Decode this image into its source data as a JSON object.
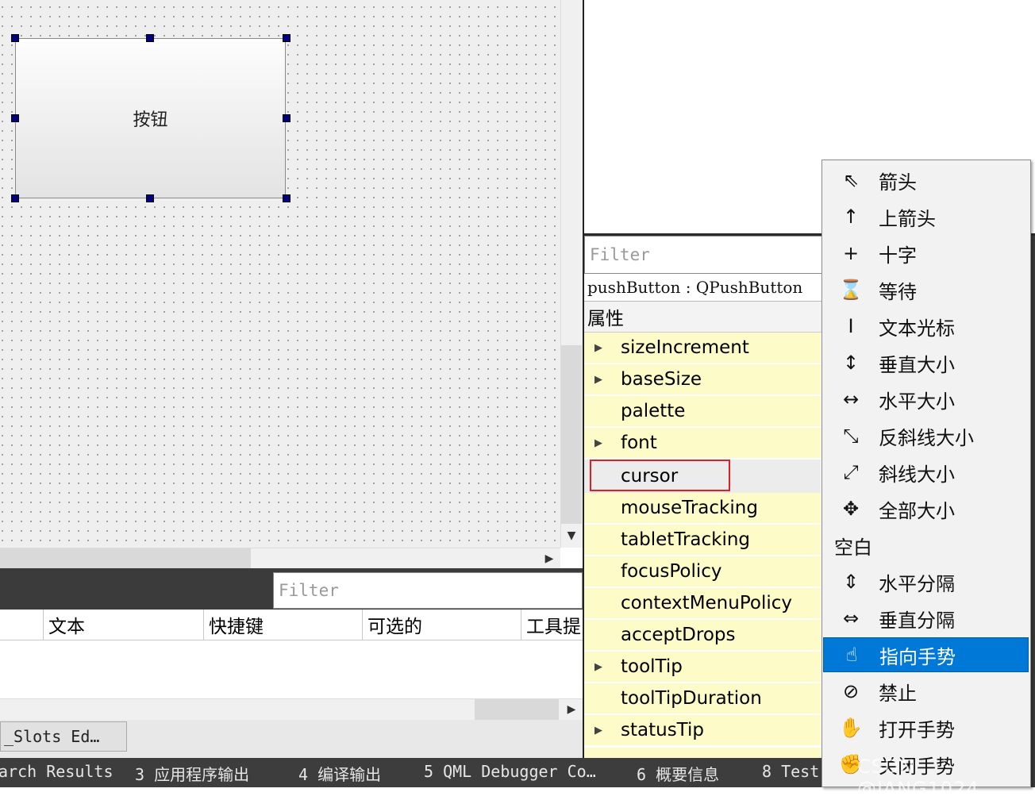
{
  "form_editor": {
    "button_text": "按钮"
  },
  "action_editor": {
    "filter_placeholder": "Filter",
    "columns": [
      "文本",
      "快捷键",
      "可选的",
      "工具提"
    ],
    "tab_label": "_Slots Ed…"
  },
  "output_bar": {
    "items": [
      "arch Results",
      "3  应用程序输出",
      "4  编译输出",
      "5  QML Debugger Co…",
      "6  概要信息",
      "8  Test"
    ]
  },
  "property_editor": {
    "filter_placeholder": "Filter",
    "object_label": "pushButton : QPushButton",
    "header": "属性",
    "rows": [
      {
        "name": "sizeIncrement",
        "expandable": true,
        "shade": "yellow"
      },
      {
        "name": "baseSize",
        "expandable": true,
        "shade": "yellow"
      },
      {
        "name": "palette",
        "expandable": false,
        "shade": "yellow"
      },
      {
        "name": "font",
        "expandable": true,
        "shade": "yellow"
      },
      {
        "name": "cursor",
        "expandable": false,
        "shade": "gray",
        "highlighted": true
      },
      {
        "name": "mouseTracking",
        "expandable": false,
        "shade": "yellow"
      },
      {
        "name": "tabletTracking",
        "expandable": false,
        "shade": "yellow"
      },
      {
        "name": "focusPolicy",
        "expandable": false,
        "shade": "yellow"
      },
      {
        "name": "contextMenuPolicy",
        "expandable": false,
        "shade": "yellow"
      },
      {
        "name": "acceptDrops",
        "expandable": false,
        "shade": "yellow"
      },
      {
        "name": "toolTip",
        "expandable": true,
        "shade": "yellow"
      },
      {
        "name": "toolTipDuration",
        "expandable": false,
        "shade": "yellow"
      },
      {
        "name": "statusTip",
        "expandable": true,
        "shade": "yellow"
      }
    ]
  },
  "cursor_menu": {
    "items": [
      {
        "label": "箭头",
        "icon": "arrow-cursor-icon",
        "glyph": "⇖"
      },
      {
        "label": "上箭头",
        "icon": "up-arrow-cursor-icon",
        "glyph": "↑"
      },
      {
        "label": "十字",
        "icon": "cross-cursor-icon",
        "glyph": "+"
      },
      {
        "label": "等待",
        "icon": "hourglass-icon",
        "glyph": "⌛"
      },
      {
        "label": "文本光标",
        "icon": "ibeam-icon",
        "glyph": "I"
      },
      {
        "label": "垂直大小",
        "icon": "size-ver-icon",
        "glyph": "↕"
      },
      {
        "label": "水平大小",
        "icon": "size-hor-icon",
        "glyph": "↔"
      },
      {
        "label": "反斜线大小",
        "icon": "size-fdiag-icon",
        "glyph": "⤡"
      },
      {
        "label": "斜线大小",
        "icon": "size-bdiag-icon",
        "glyph": "⤢"
      },
      {
        "label": "全部大小",
        "icon": "size-all-icon",
        "glyph": "✥"
      },
      {
        "label": "空白",
        "icon": "",
        "glyph": ""
      },
      {
        "label": "水平分隔",
        "icon": "split-v-icon",
        "glyph": "⇕"
      },
      {
        "label": "垂直分隔",
        "icon": "split-h-icon",
        "glyph": "⇔"
      },
      {
        "label": "指向手势",
        "icon": "pointing-hand-icon",
        "glyph": "☝",
        "selected": true
      },
      {
        "label": "禁止",
        "icon": "forbidden-icon",
        "glyph": "⊘"
      },
      {
        "label": "打开手势",
        "icon": "open-hand-icon",
        "glyph": "✋"
      },
      {
        "label": "关闭手势",
        "icon": "closed-hand-icon",
        "glyph": "✊"
      }
    ],
    "selected_color": "#0078d7"
  },
  "watermark": "CSDN @JANG1024"
}
